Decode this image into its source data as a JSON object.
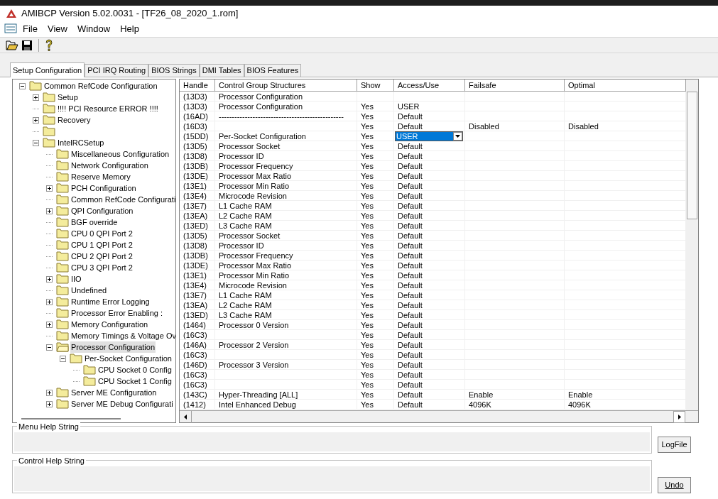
{
  "window": {
    "title": "AMIBCP Version 5.02.0031 - [TF26_08_2020_1.rom]"
  },
  "menu": [
    "File",
    "View",
    "Window",
    "Help"
  ],
  "tabs": [
    {
      "label": "Setup Configuration",
      "selected": true
    },
    {
      "label": "PCI IRQ Routing",
      "selected": false
    },
    {
      "label": "BIOS Strings",
      "selected": false
    },
    {
      "label": "DMI Tables",
      "selected": false
    },
    {
      "label": "BIOS Features",
      "selected": false
    }
  ],
  "tree": [
    {
      "label": "Common RefCode Configuration",
      "kind": "expanded",
      "selected": false,
      "children": [
        {
          "label": "Setup",
          "kind": "collapsed",
          "selected": false
        },
        {
          "label": "!!!! PCI Resource ERROR !!!!",
          "kind": "leaf",
          "selected": false
        },
        {
          "label": "Recovery",
          "kind": "collapsed",
          "selected": false
        },
        {
          "kind": "leaf",
          "selected": false
        },
        {
          "label": "IntelRCSetup",
          "kind": "expanded",
          "selected": false,
          "children": [
            {
              "label": "Miscellaneous Configuration",
              "kind": "leaf",
              "selected": false
            },
            {
              "label": "Network Configuration",
              "kind": "leaf",
              "selected": false
            },
            {
              "label": "Reserve Memory",
              "kind": "leaf",
              "selected": false
            },
            {
              "label": "PCH Configuration",
              "kind": "collapsed",
              "selected": false
            },
            {
              "label": "Common RefCode Configurati",
              "kind": "leaf",
              "selected": false
            },
            {
              "label": "QPI Configuration",
              "kind": "collapsed",
              "selected": false
            },
            {
              "label": "BGF override",
              "kind": "leaf",
              "selected": false
            },
            {
              "label": "CPU 0 QPI Port 2",
              "kind": "leaf",
              "selected": false
            },
            {
              "label": "CPU 1 QPI Port 2",
              "kind": "leaf",
              "selected": false
            },
            {
              "label": "CPU 2 QPI Port 2",
              "kind": "leaf",
              "selected": false
            },
            {
              "label": "CPU 3 QPI Port 2",
              "kind": "leaf",
              "selected": false
            },
            {
              "label": "IIO",
              "kind": "collapsed",
              "selected": false
            },
            {
              "label": "Undefined",
              "kind": "leaf",
              "selected": false
            },
            {
              "label": "Runtime Error Logging",
              "kind": "collapsed",
              "selected": false
            },
            {
              "label": "Processor Error Enabling :",
              "kind": "leaf",
              "selected": false
            },
            {
              "label": "Memory Configuration",
              "kind": "collapsed",
              "selected": false
            },
            {
              "label": "Memory Timings & Voltage Ov",
              "kind": "leaf",
              "selected": false
            },
            {
              "label": "Processor Configuration",
              "kind": "expanded",
              "selected": true,
              "children": [
                {
                  "label": "Per-Socket Configuration",
                  "kind": "expanded",
                  "selected": false,
                  "children": [
                    {
                      "label": "CPU Socket 0 Config",
                      "kind": "leaf",
                      "selected": false
                    },
                    {
                      "label": "CPU Socket 1 Config",
                      "kind": "leaf",
                      "selected": false
                    }
                  ]
                }
              ]
            },
            {
              "label": "Server ME Configuration",
              "kind": "collapsed",
              "selected": false
            },
            {
              "label": "Server ME Debug Configurati",
              "kind": "collapsed",
              "selected": false
            }
          ]
        }
      ]
    }
  ],
  "table": {
    "columns": [
      "Handle",
      "Control Group Structures",
      "Show",
      "Access/Use",
      "Failsafe",
      "Optimal"
    ],
    "rows": [
      {
        "handle": "(13D3)",
        "name": "Processor Configuration"
      },
      {
        "handle": "(13D3)",
        "name": "Processor Configuration",
        "show": "Yes",
        "access": "USER"
      },
      {
        "handle": "(16AD)",
        "name": "------------------------------------------------",
        "show": "Yes",
        "access": "Default"
      },
      {
        "handle": "(16D3)",
        "show": "Yes",
        "access": "Default",
        "failsafe": "Disabled",
        "optimal": "Disabled"
      },
      {
        "handle": "(15DD)",
        "name": "Per-Socket Configuration",
        "show": "Yes",
        "access": "USER",
        "editing": true
      },
      {
        "handle": "(13D5)",
        "name": "Processor Socket",
        "show": "Yes",
        "access": "Default"
      },
      {
        "handle": "(13D8)",
        "name": "Processor ID",
        "show": "Yes",
        "access": "Default"
      },
      {
        "handle": "(13DB)",
        "name": "Processor Frequency",
        "show": "Yes",
        "access": "Default"
      },
      {
        "handle": "(13DE)",
        "name": "Processor Max Ratio",
        "show": "Yes",
        "access": "Default"
      },
      {
        "handle": "(13E1)",
        "name": "Processor Min Ratio",
        "show": "Yes",
        "access": "Default"
      },
      {
        "handle": "(13E4)",
        "name": "Microcode Revision",
        "show": "Yes",
        "access": "Default"
      },
      {
        "handle": "(13E7)",
        "name": "L1 Cache RAM",
        "show": "Yes",
        "access": "Default"
      },
      {
        "handle": "(13EA)",
        "name": "L2 Cache RAM",
        "show": "Yes",
        "access": "Default"
      },
      {
        "handle": "(13ED)",
        "name": "L3 Cache RAM",
        "show": "Yes",
        "access": "Default"
      },
      {
        "handle": "(13D5)",
        "name": "Processor Socket",
        "show": "Yes",
        "access": "Default"
      },
      {
        "handle": "(13D8)",
        "name": "Processor ID",
        "show": "Yes",
        "access": "Default"
      },
      {
        "handle": "(13DB)",
        "name": "Processor Frequency",
        "show": "Yes",
        "access": "Default"
      },
      {
        "handle": "(13DE)",
        "name": "Processor Max Ratio",
        "show": "Yes",
        "access": "Default"
      },
      {
        "handle": "(13E1)",
        "name": "Processor Min Ratio",
        "show": "Yes",
        "access": "Default"
      },
      {
        "handle": "(13E4)",
        "name": "Microcode Revision",
        "show": "Yes",
        "access": "Default"
      },
      {
        "handle": "(13E7)",
        "name": "L1 Cache RAM",
        "show": "Yes",
        "access": "Default"
      },
      {
        "handle": "(13EA)",
        "name": "L2 Cache RAM",
        "show": "Yes",
        "access": "Default"
      },
      {
        "handle": "(13ED)",
        "name": "L3 Cache RAM",
        "show": "Yes",
        "access": "Default"
      },
      {
        "handle": "(1464)",
        "name": "Processor 0 Version",
        "show": "Yes",
        "access": "Default"
      },
      {
        "handle": "(16C3)",
        "show": "Yes",
        "access": "Default"
      },
      {
        "handle": "(146A)",
        "name": "Processor 2 Version",
        "show": "Yes",
        "access": "Default"
      },
      {
        "handle": "(16C3)",
        "show": "Yes",
        "access": "Default"
      },
      {
        "handle": "(146D)",
        "name": "Processor 3 Version",
        "show": "Yes",
        "access": "Default"
      },
      {
        "handle": "(16C3)",
        "show": "Yes",
        "access": "Default"
      },
      {
        "handle": "(16C3)",
        "show": "Yes",
        "access": "Default"
      },
      {
        "handle": "(143C)",
        "name": "Hyper-Threading [ALL]",
        "show": "Yes",
        "access": "Default",
        "failsafe": "Enable",
        "optimal": "Enable"
      },
      {
        "handle": "(1412)",
        "name": "Intel Enhanced Debug",
        "show": "Yes",
        "access": "Default",
        "failsafe": "4096K",
        "optimal": "4096K"
      }
    ]
  },
  "menu_help": {
    "label": "Menu Help String"
  },
  "control_help": {
    "label": "Control Help String"
  },
  "buttons": [
    "LogFile",
    "Undo"
  ]
}
